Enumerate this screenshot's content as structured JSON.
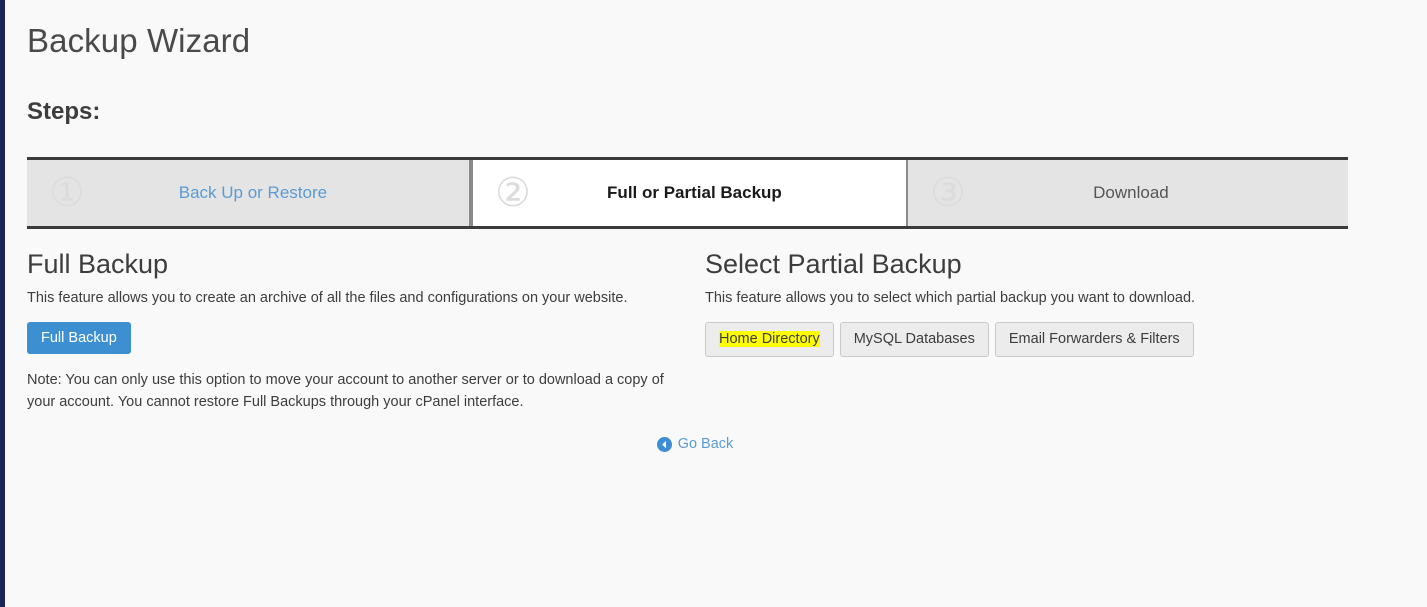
{
  "page": {
    "title": "Backup Wizard",
    "steps_heading": "Steps:"
  },
  "steps": [
    {
      "number": "①",
      "label": "Back Up or Restore",
      "state": "link"
    },
    {
      "number": "②",
      "label": "Full or Partial Backup",
      "state": "current"
    },
    {
      "number": "③",
      "label": "Download",
      "state": "muted"
    }
  ],
  "full_backup": {
    "title": "Full Backup",
    "description": "This feature allows you to create an archive of all the files and configurations on your website.",
    "button_label": "Full Backup",
    "note": "Note: You can only use this option to move your account to another server or to download a copy of your account. You cannot restore Full Backups through your cPanel interface."
  },
  "partial_backup": {
    "title": "Select Partial Backup",
    "description": "This feature allows you to select which partial backup you want to download.",
    "options": [
      {
        "label": "Home Directory",
        "highlighted": true
      },
      {
        "label": "MySQL Databases",
        "highlighted": false
      },
      {
        "label": "Email Forwarders & Filters",
        "highlighted": false
      }
    ]
  },
  "footer": {
    "go_back_label": "Go Back",
    "go_back_icon": "circle-left-arrow-icon"
  },
  "colors": {
    "accent_blue": "#3c90d2",
    "link_blue": "#5b9bd5",
    "highlight_yellow": "#ffff00",
    "rail_navy": "#1d2552",
    "page_background": "#f9f9f9",
    "step_inactive": "#e4e4e4"
  }
}
